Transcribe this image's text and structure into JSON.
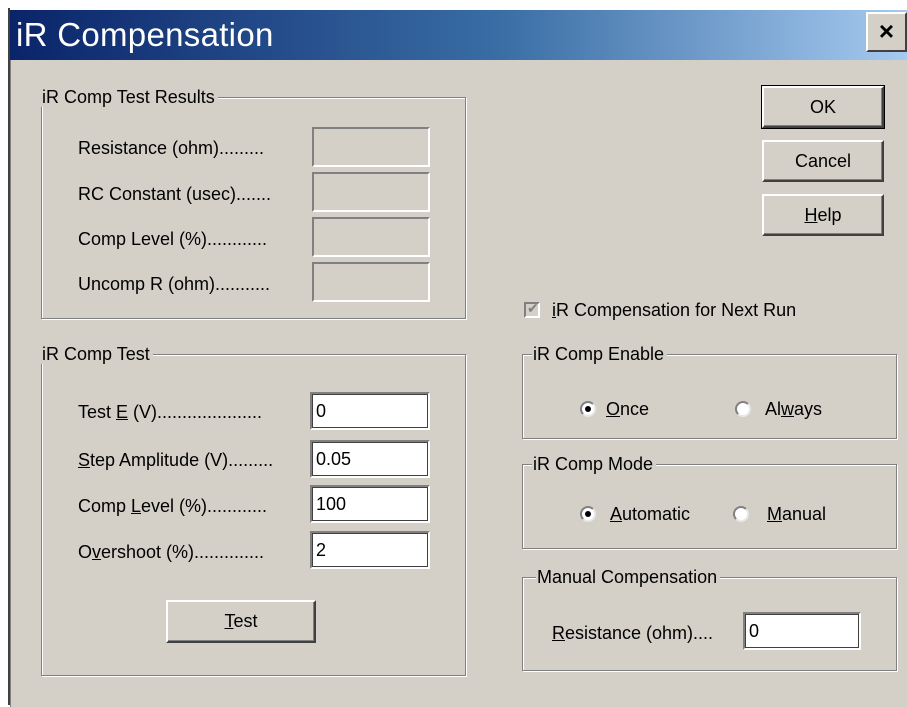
{
  "window": {
    "title": "iR Compensation",
    "close_glyph": "×"
  },
  "results": {
    "legend": "iR Comp Test Results",
    "rows": [
      {
        "label": "Resistance (ohm).........",
        "value": ""
      },
      {
        "label": "RC Constant (usec).......",
        "value": ""
      },
      {
        "label": "Comp Level (%)............",
        "value": ""
      },
      {
        "label": "Uncomp R (ohm)...........",
        "value": ""
      }
    ]
  },
  "test": {
    "legend": "iR Comp Test",
    "rows": [
      {
        "pre": "Test ",
        "u": "E",
        "post": " (V).....................",
        "value": "0"
      },
      {
        "pre": "",
        "u": "S",
        "post": "tep Amplitude (V).........",
        "value": "0.05"
      },
      {
        "pre": "Comp ",
        "u": "L",
        "post": "evel (%)............",
        "value": "100"
      },
      {
        "pre": "O",
        "u": "v",
        "post": "ershoot (%)..............",
        "value": "2"
      }
    ],
    "button": {
      "u": "T",
      "post": "est"
    }
  },
  "buttons": {
    "ok": "OK",
    "cancel": "Cancel",
    "help_u": "H",
    "help_post": "elp"
  },
  "next_run": {
    "checked": true,
    "u": "i",
    "post": "R Compensation for Next Run"
  },
  "enable": {
    "legend": "iR Comp Enable",
    "once_u": "O",
    "once_post": "nce",
    "always_pre": "Al",
    "always_u": "w",
    "always_post": "ays",
    "selected": "once"
  },
  "mode": {
    "legend": "iR Comp Mode",
    "auto_u": "A",
    "auto_post": "utomatic",
    "manual_u": "M",
    "manual_post": "anual",
    "selected": "automatic"
  },
  "manual": {
    "legend": "Manual Compensation",
    "label_u": "R",
    "label_post": "esistance (ohm)....",
    "value": "0"
  }
}
